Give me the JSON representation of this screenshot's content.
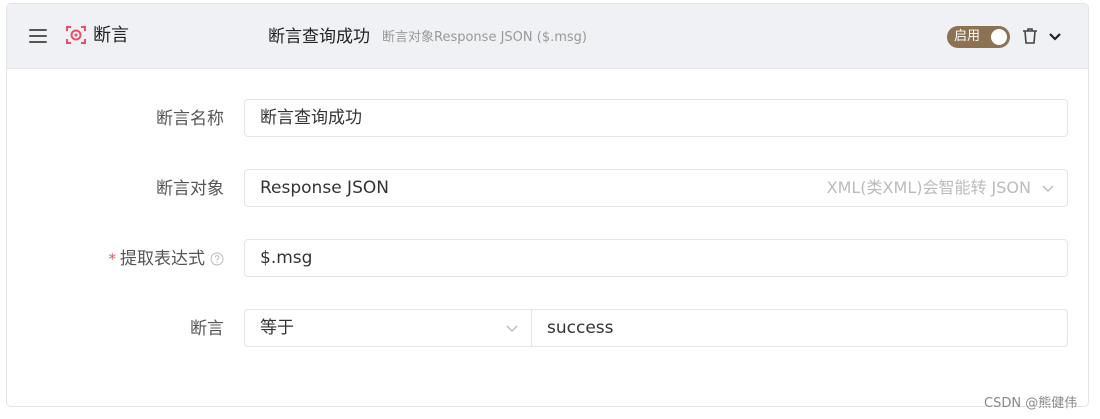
{
  "header": {
    "type_label": "断言",
    "title": "断言查询成功",
    "subtitle": "断言对象Response JSON ($.msg)",
    "toggle_label": "启用",
    "toggle_on": true,
    "icons": {
      "drag": "hamburger-icon",
      "type": "assert-target-icon",
      "delete": "trash-icon",
      "collapse": "chevron-down-icon"
    }
  },
  "form": {
    "name": {
      "label": "断言名称",
      "value": "断言查询成功"
    },
    "target": {
      "label": "断言对象",
      "value": "Response JSON",
      "hint": "XML(类XML)会智能转 JSON"
    },
    "expression": {
      "label": "提取表达式",
      "required_mark": "*",
      "value": "$.msg"
    },
    "assertion": {
      "label": "断言",
      "operator": "等于",
      "value": "success"
    }
  },
  "watermark": "CSDN @熊健伟",
  "colors": {
    "accent": "#8c7152",
    "icon_red": "#e94f66",
    "header_bg": "#f0f1f4"
  }
}
